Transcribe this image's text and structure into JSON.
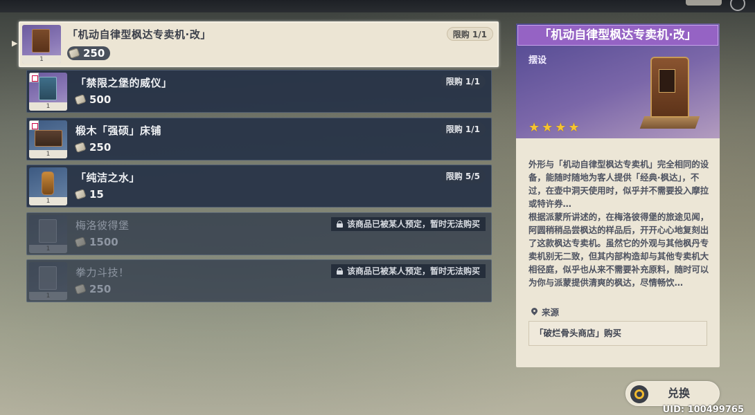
{
  "shop": {
    "items": [
      {
        "name": "「机动自律型枫达专卖机·改」",
        "price": "250",
        "qty": "1",
        "limit": "限购 1/1",
        "locked": false,
        "selected": true
      },
      {
        "name": "「禁限之堡的威仪」",
        "price": "500",
        "qty": "1",
        "limit": "限购 1/1",
        "locked": false,
        "selected": false
      },
      {
        "name": "椴木「强硕」床铺",
        "price": "250",
        "qty": "1",
        "limit": "限购 1/1",
        "locked": false,
        "selected": false
      },
      {
        "name": "「纯洁之水」",
        "price": "15",
        "qty": "1",
        "limit": "限购 5/5",
        "locked": false,
        "selected": false
      },
      {
        "name": "梅洛彼得堡",
        "price": "1500",
        "qty": "1",
        "lock_note": "该商品已被某人预定，暂时无法购买",
        "locked": true,
        "selected": false
      },
      {
        "name": "拳力斗技！",
        "price": "250",
        "qty": "1",
        "lock_note": "该商品已被某人预定，暂时无法购买",
        "locked": true,
        "selected": false
      }
    ]
  },
  "detail": {
    "title": "「机动自律型枫达专卖机·改」",
    "type": "摆设",
    "stars": 4,
    "description": "外形与「机动自律型枫达专卖机」完全相同的设备，能随时随地为客人提供「经典·枫达」，不过，在壶中洞天使用时，似乎并不需要投入摩拉或特许券…\n根据派蒙所讲述的，在梅洛彼得堡的旅途见闻，阿圆稍稍品尝枫达的样品后，开开心心地复刻出了这款枫达专卖机。虽然它的外观与其他枫丹专卖机别无二致，但其内部构造却与其他专卖机大相径庭，似乎也从来不需要补充原料，随时可以为你与派蒙提供清爽的枫达，尽情畅饮…",
    "source_label": "来源",
    "source_value": "「破烂骨头商店」购买"
  },
  "actions": {
    "exchange_label": "兑换"
  },
  "footer": {
    "uid": "UID: 100499765"
  },
  "colors": {
    "title_bar": "#9563c4",
    "panel_bg": "#ece6d6",
    "row_bg": "#263246",
    "star": "#f6c431"
  }
}
